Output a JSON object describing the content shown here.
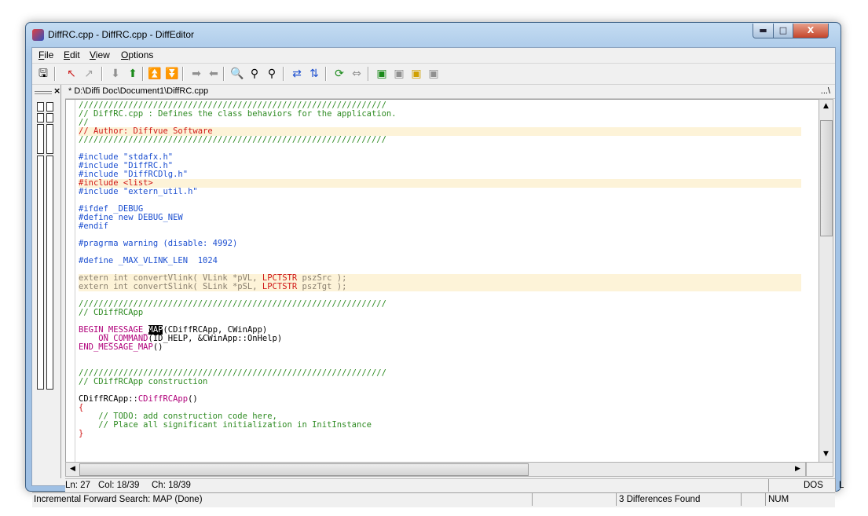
{
  "window": {
    "title": "DiffRC.cpp - DiffRC.cpp - DiffEditor",
    "min_glyph": "▬",
    "max_glyph": "□",
    "close_glyph": "X"
  },
  "menu": [
    "File",
    "Edit",
    "View",
    "Options"
  ],
  "toolbar_icons": [
    {
      "name": "save-icon",
      "glyph": "🖫",
      "color": "#000000"
    },
    {
      "name": "undo-diff-icon",
      "glyph": "↖",
      "color": "#cc2020"
    },
    {
      "name": "redo-diff-icon",
      "glyph": "↗",
      "color": "#a0a0a0"
    },
    {
      "name": "next-diff-icon",
      "glyph": "⬇",
      "color": "#909090"
    },
    {
      "name": "prev-diff-icon",
      "glyph": "⬆",
      "color": "#1a8a1a"
    },
    {
      "name": "first-diff-icon",
      "glyph": "⏫",
      "color": "#1a8a1a"
    },
    {
      "name": "last-diff-icon",
      "glyph": "⏬",
      "color": "#909090"
    },
    {
      "name": "copy-right-icon",
      "glyph": "➡",
      "color": "#909090"
    },
    {
      "name": "copy-left-icon",
      "glyph": "⬅",
      "color": "#909090"
    },
    {
      "name": "find-icon",
      "glyph": "🔍",
      "color": "#000000"
    },
    {
      "name": "find-next-icon",
      "glyph": "⚲",
      "color": "#000000"
    },
    {
      "name": "find-prev-icon",
      "glyph": "⚲",
      "color": "#000000"
    },
    {
      "name": "swap-icon",
      "glyph": "⇄",
      "color": "#1c4fd0"
    },
    {
      "name": "sync-icon",
      "glyph": "⇅",
      "color": "#1c4fd0"
    },
    {
      "name": "refresh-icon",
      "glyph": "⟳",
      "color": "#1a8a1a"
    },
    {
      "name": "exchange-icon",
      "glyph": "⇔",
      "color": "#909090"
    },
    {
      "name": "layout-1-icon",
      "glyph": "▣",
      "color": "#1a8a1a"
    },
    {
      "name": "layout-2-icon",
      "glyph": "▣",
      "color": "#909090"
    },
    {
      "name": "layout-3-icon",
      "glyph": "▣",
      "color": "#d0a000"
    },
    {
      "name": "layout-4-icon",
      "glyph": "▣",
      "color": "#909090"
    }
  ],
  "panel_close": "×",
  "path": "* D:\\Diffi Doc\\Document1\\DiffRC.cpp",
  "path_more": "...\\",
  "code_lines": [
    {
      "segs": [
        {
          "t": "//////////////////////////////////////////////////////////////",
          "c": "green"
        }
      ]
    },
    {
      "segs": [
        {
          "t": "// DiffRC.cpp : Defines the class behaviors for the application.",
          "c": "green"
        }
      ]
    },
    {
      "segs": [
        {
          "t": "//",
          "c": "green"
        }
      ]
    },
    {
      "hl": true,
      "segs": [
        {
          "t": "// Author: Diffvue Software",
          "c": "red"
        }
      ]
    },
    {
      "segs": [
        {
          "t": "//////////////////////////////////////////////////////////////",
          "c": "green"
        }
      ]
    },
    {
      "segs": []
    },
    {
      "segs": [
        {
          "t": "#include \"stdafx.h\"",
          "c": "blue"
        }
      ]
    },
    {
      "segs": [
        {
          "t": "#include \"DiffRC.h\"",
          "c": "blue"
        }
      ]
    },
    {
      "segs": [
        {
          "t": "#include \"DiffRCDlg.h\"",
          "c": "blue"
        }
      ]
    },
    {
      "hl": true,
      "segs": [
        {
          "t": "#include <list>",
          "c": "red"
        }
      ]
    },
    {
      "segs": [
        {
          "t": "#include \"extern_util.h\"",
          "c": "blue"
        }
      ]
    },
    {
      "segs": []
    },
    {
      "segs": [
        {
          "t": "#ifdef _DEBUG",
          "c": "blue"
        }
      ]
    },
    {
      "segs": [
        {
          "t": "#define new DEBUG_NEW",
          "c": "blue"
        }
      ]
    },
    {
      "segs": [
        {
          "t": "#endif",
          "c": "blue"
        }
      ]
    },
    {
      "segs": []
    },
    {
      "segs": [
        {
          "t": "#pragrma warning (disable: 4992)",
          "c": "blue"
        }
      ]
    },
    {
      "segs": []
    },
    {
      "segs": [
        {
          "t": "#define _MAX_VLINK_LEN  1024",
          "c": "blue"
        }
      ]
    },
    {
      "segs": []
    },
    {
      "hl": true,
      "segs": [
        {
          "t": "extern int convertVlink( VLink *pVL, ",
          "c": "gray"
        },
        {
          "t": "LPCTSTR",
          "c": "red"
        },
        {
          "t": " pszSrc );",
          "c": "gray"
        }
      ]
    },
    {
      "hl": true,
      "segs": [
        {
          "t": "extern int convertSlink( SLink *pSL, ",
          "c": "gray"
        },
        {
          "t": "LPCTSTR",
          "c": "red"
        },
        {
          "t": " pszTgt );",
          "c": "gray"
        }
      ]
    },
    {
      "segs": []
    },
    {
      "segs": [
        {
          "t": "//////////////////////////////////////////////////////////////",
          "c": "green"
        }
      ]
    },
    {
      "segs": [
        {
          "t": "// CDiffRCApp",
          "c": "green"
        }
      ]
    },
    {
      "segs": []
    },
    {
      "segs": [
        {
          "t": "BEGIN_MESSAGE_",
          "c": "mag"
        },
        {
          "t": "MAP",
          "c": "sel"
        },
        {
          "t": "(CDiffRCApp, CWinApp)",
          "c": "black"
        }
      ]
    },
    {
      "segs": [
        {
          "t": "    ON_COMMAND",
          "c": "mag"
        },
        {
          "t": "(ID_HELP, &CWinApp::OnHelp)",
          "c": "black"
        }
      ]
    },
    {
      "segs": [
        {
          "t": "END_MESSAGE_MAP",
          "c": "mag"
        },
        {
          "t": "()",
          "c": "black"
        }
      ]
    },
    {
      "segs": []
    },
    {
      "segs": []
    },
    {
      "segs": [
        {
          "t": "//////////////////////////////////////////////////////////////",
          "c": "green"
        }
      ]
    },
    {
      "segs": [
        {
          "t": "// CDiffRCApp construction",
          "c": "green"
        }
      ]
    },
    {
      "segs": []
    },
    {
      "segs": [
        {
          "t": "CDiffRCApp::",
          "c": "black"
        },
        {
          "t": "CDiffRCApp",
          "c": "mag"
        },
        {
          "t": "()",
          "c": "black"
        }
      ]
    },
    {
      "segs": [
        {
          "t": "{",
          "c": "red"
        }
      ]
    },
    {
      "segs": [
        {
          "t": "    // TODO: add construction code here,",
          "c": "green"
        }
      ]
    },
    {
      "segs": [
        {
          "t": "    // Place all significant initialization in InitInstance",
          "c": "green"
        }
      ]
    },
    {
      "segs": [
        {
          "t": "}",
          "c": "red"
        }
      ]
    }
  ],
  "status_line": {
    "ln": "Ln: 27",
    "col": "Col: 18/39",
    "ch": "Ch: 18/39",
    "format": "DOS",
    "mode": "L"
  },
  "status_bar": {
    "message": "Incremental Forward Search: MAP (Done)",
    "differences": "3 Differences Found",
    "num": "NUM"
  }
}
